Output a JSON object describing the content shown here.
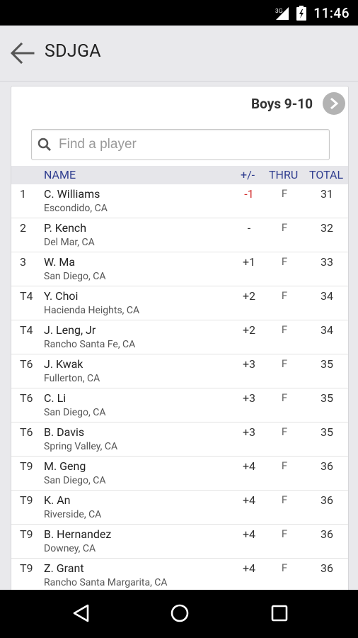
{
  "status_bar": {
    "network": "3G",
    "time": "11:46"
  },
  "app_bar": {
    "title": "SDJGA"
  },
  "division": {
    "label": "Boys 9-10"
  },
  "search": {
    "placeholder": "Find a player"
  },
  "columns": {
    "name": "NAME",
    "to_par": "+/-",
    "thru": "THRU",
    "total": "TOTAL"
  },
  "colors": {
    "to_par_under": "#d32f2f",
    "header_text": "#2f3d8f"
  },
  "players": [
    {
      "pos": "1",
      "name": "C. Williams",
      "city": "Escondido, CA",
      "to_par": "-1",
      "thru": "F",
      "total": "31"
    },
    {
      "pos": "2",
      "name": "P. Kench",
      "city": "Del Mar, CA",
      "to_par": "-",
      "thru": "F",
      "total": "32"
    },
    {
      "pos": "3",
      "name": "W. Ma",
      "city": "San Diego, CA",
      "to_par": "+1",
      "thru": "F",
      "total": "33"
    },
    {
      "pos": "T4",
      "name": "Y. Choi",
      "city": "Hacienda Heights, CA",
      "to_par": "+2",
      "thru": "F",
      "total": "34"
    },
    {
      "pos": "T4",
      "name": "J. Leng, Jr",
      "city": "Rancho Santa Fe, CA",
      "to_par": "+2",
      "thru": "F",
      "total": "34"
    },
    {
      "pos": "T6",
      "name": "J. Kwak",
      "city": "Fullerton, CA",
      "to_par": "+3",
      "thru": "F",
      "total": "35"
    },
    {
      "pos": "T6",
      "name": "C. Li",
      "city": "San Diego, CA",
      "to_par": "+3",
      "thru": "F",
      "total": "35"
    },
    {
      "pos": "T6",
      "name": "B. Davis",
      "city": "Spring Valley, CA",
      "to_par": "+3",
      "thru": "F",
      "total": "35"
    },
    {
      "pos": "T9",
      "name": "M. Geng",
      "city": "San Diego, CA",
      "to_par": "+4",
      "thru": "F",
      "total": "36"
    },
    {
      "pos": "T9",
      "name": "K. An",
      "city": "Riverside, CA",
      "to_par": "+4",
      "thru": "F",
      "total": "36"
    },
    {
      "pos": "T9",
      "name": "B. Hernandez",
      "city": "Downey, CA",
      "to_par": "+4",
      "thru": "F",
      "total": "36"
    },
    {
      "pos": "T9",
      "name": "Z. Grant",
      "city": "Rancho Santa Margarita, CA",
      "to_par": "+4",
      "thru": "F",
      "total": "36"
    }
  ]
}
